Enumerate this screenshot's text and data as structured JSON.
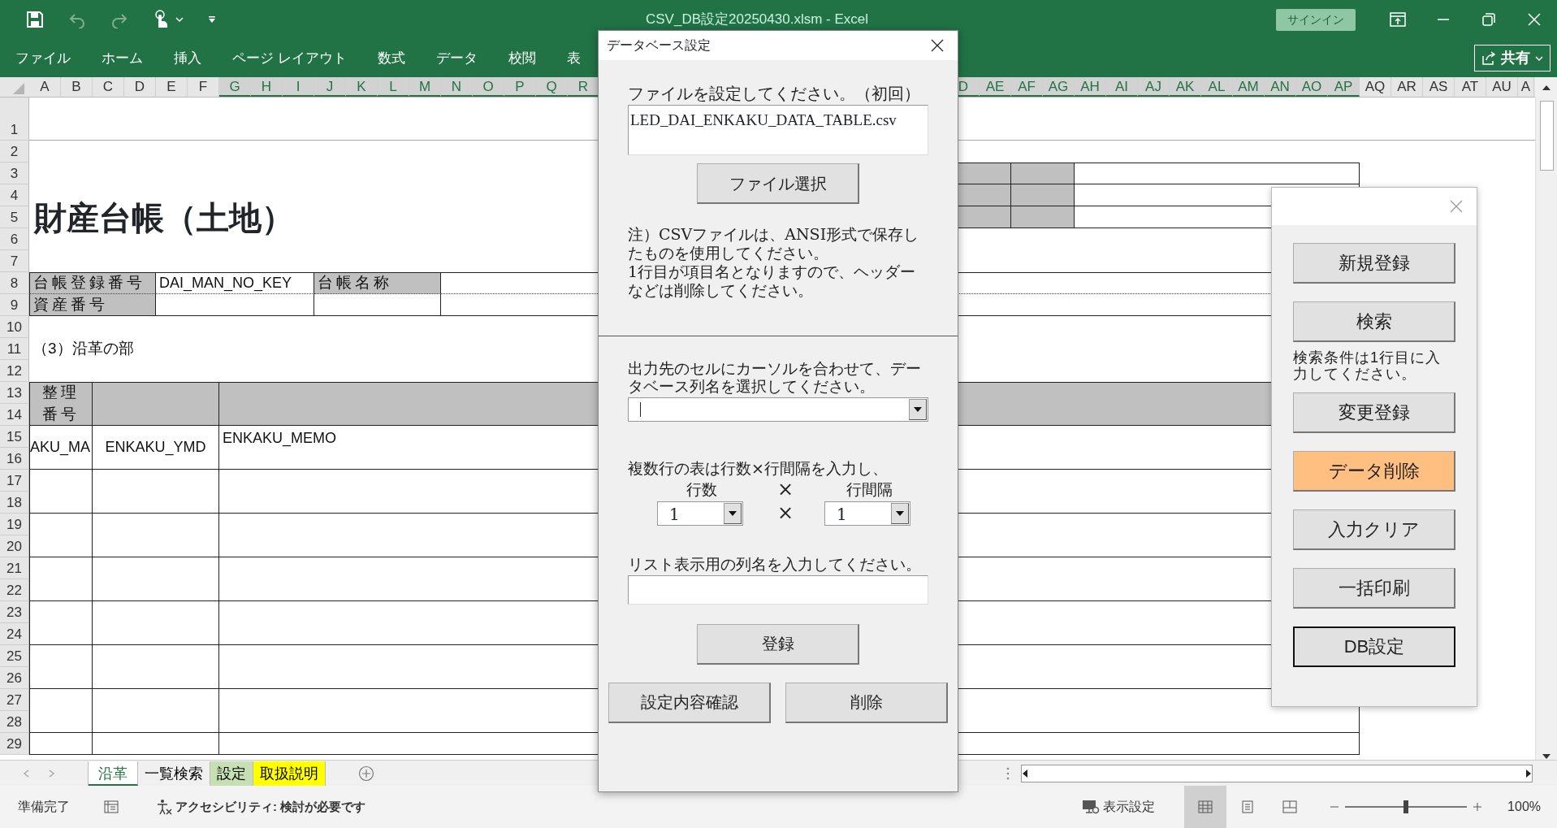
{
  "title_bar": {
    "title": "CSV_DB設定20250430.xlsm  -  Excel",
    "sign_in": "サインイン"
  },
  "ribbon": {
    "tabs": [
      "ファイル",
      "ホーム",
      "挿入",
      "ページ レイアウト",
      "数式",
      "データ",
      "校閲",
      "表"
    ],
    "share": "共有"
  },
  "sheet": {
    "columns": [
      {
        "label": "A",
        "selected": false
      },
      {
        "label": "B",
        "selected": false
      },
      {
        "label": "C",
        "selected": false
      },
      {
        "label": "D",
        "selected": false
      },
      {
        "label": "E",
        "selected": false
      },
      {
        "label": "F",
        "selected": false
      },
      {
        "label": "G",
        "selected": true
      },
      {
        "label": "H",
        "selected": true
      },
      {
        "label": "I",
        "selected": true
      },
      {
        "label": "J",
        "selected": true
      },
      {
        "label": "K",
        "selected": true
      },
      {
        "label": "L",
        "selected": true
      },
      {
        "label": "M",
        "selected": true
      },
      {
        "label": "N",
        "selected": true
      },
      {
        "label": "O",
        "selected": true
      },
      {
        "label": "P",
        "selected": true
      },
      {
        "label": "Q",
        "selected": true
      },
      {
        "label": "R",
        "selected": true
      },
      {
        "label": "D",
        "selected": true
      },
      {
        "label": "AE",
        "selected": true
      },
      {
        "label": "AF",
        "selected": true
      },
      {
        "label": "AG",
        "selected": true
      },
      {
        "label": "AH",
        "selected": true
      },
      {
        "label": "AI",
        "selected": true
      },
      {
        "label": "AJ",
        "selected": true
      },
      {
        "label": "AK",
        "selected": true
      },
      {
        "label": "AL",
        "selected": true
      },
      {
        "label": "AM",
        "selected": true
      },
      {
        "label": "AN",
        "selected": true
      },
      {
        "label": "AO",
        "selected": true
      },
      {
        "label": "AP",
        "selected": true
      },
      {
        "label": "AQ",
        "selected": false
      },
      {
        "label": "AR",
        "selected": false
      },
      {
        "label": "AS",
        "selected": false
      },
      {
        "label": "AT",
        "selected": false
      },
      {
        "label": "AU",
        "selected": false
      },
      {
        "label": "A",
        "selected": false
      }
    ],
    "rows": [
      "1",
      "2",
      "3",
      "4",
      "5",
      "6",
      "7",
      "8",
      "9",
      "10",
      "11",
      "12",
      "13",
      "14",
      "15",
      "16",
      "17",
      "18",
      "19",
      "20",
      "21",
      "22",
      "23",
      "24",
      "25",
      "26",
      "27",
      "28",
      "29"
    ],
    "cells": [
      "財産台帳（土地）",
      "台帳登録番号",
      "DAI_MAN_NO_KEY",
      "台帳名称",
      "資産番号",
      "（3）沿革の部",
      "整理番号",
      "AKU_MA",
      "ENKAKU_YMD",
      "ENKAKU_MEMO"
    ]
  },
  "dialog": {
    "title": "データベース設定",
    "file_label": "ファイルを設定してください。（初回）",
    "file_value": "LED_DAI_ENKAKU_DATA_TABLE.csv",
    "file_button": "ファイル選択",
    "notes": [
      "注）CSVファイルは、ANSI形式で保存したものを使用してください。",
      "1行目が項目名となりますので、ヘッダーなどは削除してください。"
    ],
    "column_label": "出力先のセルにカーソルを合わせて、データベース列名を選択してください。",
    "rows_label": "複数行の表は行数×行間隔を入力し、",
    "row_count": {
      "label": "行数",
      "value": "1"
    },
    "times": [
      "×",
      "×"
    ],
    "row_interval": {
      "label": "行間隔",
      "value": "1"
    },
    "list_label": "リスト表示用の列名を入力してください。",
    "register_button": "登録",
    "buttons": [
      "設定内容確認",
      "削除"
    ]
  },
  "side_panel": {
    "items": [
      {
        "kind": "button",
        "label": "新規登録",
        "highlighted": false,
        "focused": false
      },
      {
        "kind": "button",
        "label": "検索",
        "highlighted": false,
        "focused": false
      },
      {
        "kind": "note",
        "label": "検索条件は1行目に入力してください。"
      },
      {
        "kind": "button",
        "label": "変更登録",
        "highlighted": false,
        "focused": false
      },
      {
        "kind": "button",
        "label": "データ削除",
        "highlighted": true,
        "focused": false
      },
      {
        "kind": "button",
        "label": "入力クリア",
        "highlighted": false,
        "focused": false
      },
      {
        "kind": "button",
        "label": "一括印刷",
        "highlighted": false,
        "focused": false
      },
      {
        "kind": "button",
        "label": "DB設定",
        "highlighted": false,
        "focused": true
      }
    ]
  },
  "sheet_tabs": [
    {
      "label": "沿革",
      "selected": true
    },
    {
      "label": "一覧検索",
      "selected": false
    },
    {
      "label": "設定",
      "selected": false,
      "color": "#c6e0b4"
    },
    {
      "label": "取扱説明",
      "selected": false,
      "color": "#ffff00"
    }
  ],
  "status_bar": {
    "ready": "準備完了",
    "accessibility": "アクセシビリティ: 検討が必要です",
    "display_settings": "表示設定",
    "views": [
      {
        "selected": true
      },
      {
        "selected": false
      },
      {
        "selected": false
      }
    ],
    "zoom": {
      "level": 0.5,
      "reading": "100%"
    }
  }
}
